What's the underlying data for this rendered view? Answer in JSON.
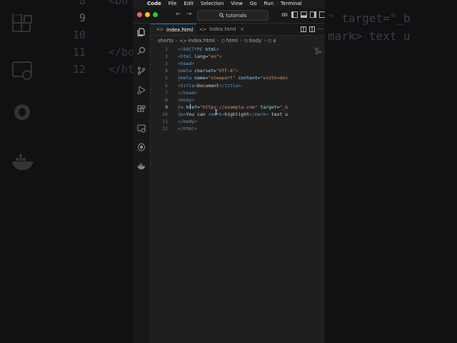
{
  "menubar": {
    "apple_icon": "",
    "items": [
      "Code",
      "File",
      "Edit",
      "Selection",
      "View",
      "Go",
      "Run",
      "Terminal"
    ]
  },
  "titlebar": {
    "command_center": "tutorials"
  },
  "tabs": [
    {
      "label": "index.html",
      "active": true
    },
    {
      "label": "index.html",
      "active": false
    }
  ],
  "breadcrumb": [
    "shorts",
    "index.html",
    "html",
    "body",
    "a"
  ],
  "editor": {
    "line_numbers": [
      "1",
      "2",
      "3",
      "4",
      "5",
      "6",
      "7",
      "8",
      "9",
      "10",
      "11",
      "12"
    ],
    "current_line": "9",
    "lines": [
      [
        [
          "t-br",
          "<!"
        ],
        [
          "t-dt",
          "DOCTYPE"
        ],
        [
          "t-txt",
          " "
        ],
        [
          "t-attr",
          "html"
        ],
        [
          "t-br",
          ">"
        ]
      ],
      [
        [
          "t-br",
          "<"
        ],
        [
          "t-tag",
          "html"
        ],
        [
          "t-txt",
          " "
        ],
        [
          "t-attr",
          "lang"
        ],
        [
          "t-txt",
          "="
        ],
        [
          "t-str",
          "\"en\""
        ],
        [
          "t-br",
          ">"
        ]
      ],
      [
        [
          "t-br",
          "<"
        ],
        [
          "t-tag",
          "head"
        ],
        [
          "t-br",
          ">"
        ]
      ],
      [
        [
          "t-txt",
          "    "
        ],
        [
          "t-br",
          "<"
        ],
        [
          "t-tag",
          "meta"
        ],
        [
          "t-txt",
          " "
        ],
        [
          "t-attr",
          "charset"
        ],
        [
          "t-txt",
          "="
        ],
        [
          "t-str",
          "\"UTF-8\""
        ],
        [
          "t-br",
          ">"
        ]
      ],
      [
        [
          "t-txt",
          "    "
        ],
        [
          "t-br",
          "<"
        ],
        [
          "t-tag",
          "meta"
        ],
        [
          "t-txt",
          " "
        ],
        [
          "t-attr",
          "name"
        ],
        [
          "t-txt",
          "="
        ],
        [
          "t-str",
          "\"viewport\""
        ],
        [
          "t-txt",
          " "
        ],
        [
          "t-attr",
          "content"
        ],
        [
          "t-txt",
          "="
        ],
        [
          "t-str",
          "\"width=dev"
        ]
      ],
      [
        [
          "t-txt",
          "    "
        ],
        [
          "t-br",
          "<"
        ],
        [
          "t-tag",
          "title"
        ],
        [
          "t-br",
          ">"
        ],
        [
          "t-txt",
          "Document"
        ],
        [
          "t-br",
          "</"
        ],
        [
          "t-tag",
          "title"
        ],
        [
          "t-br",
          ">"
        ]
      ],
      [
        [
          "t-br",
          "</"
        ],
        [
          "t-tag",
          "head"
        ],
        [
          "t-br",
          ">"
        ]
      ],
      [
        [
          "t-br",
          "<"
        ],
        [
          "t-tag",
          "body"
        ],
        [
          "t-br",
          ">"
        ]
      ],
      [
        [
          "t-txt",
          "    "
        ],
        [
          "t-br",
          "<"
        ],
        [
          "t-tag",
          "a"
        ],
        [
          "t-txt",
          " "
        ],
        [
          "t-attr",
          "href"
        ],
        [
          "t-txt",
          "="
        ],
        [
          "t-str",
          "\"https://example.com\""
        ],
        [
          "t-txt",
          " "
        ],
        [
          "t-attr",
          "target"
        ],
        [
          "t-txt",
          "="
        ],
        [
          "t-str",
          "\"_b"
        ]
      ],
      [
        [
          "t-txt",
          "    "
        ],
        [
          "t-br",
          "<"
        ],
        [
          "t-tag",
          "p"
        ],
        [
          "t-br",
          ">"
        ],
        [
          "t-txt",
          "You can "
        ],
        [
          "t-br",
          "<"
        ],
        [
          "t-tag",
          "mark"
        ],
        [
          "t-br",
          ">"
        ],
        [
          "t-txt",
          "highlight"
        ],
        [
          "t-br",
          "</"
        ],
        [
          "t-tag",
          "mark"
        ],
        [
          "t-br",
          ">"
        ],
        [
          "t-txt",
          " text u"
        ]
      ],
      [
        [
          "t-br",
          "</"
        ],
        [
          "t-tag",
          "body"
        ],
        [
          "t-br",
          ">"
        ]
      ],
      [
        [
          "t-br",
          "</"
        ],
        [
          "t-tag",
          "html"
        ],
        [
          "t-br",
          ">"
        ]
      ]
    ]
  },
  "background_left": {
    "line_numbers": [
      "8",
      "9",
      "10",
      "11",
      "12"
    ],
    "code": [
      "<bo",
      "",
      "",
      "</bo",
      "</ht"
    ]
  },
  "background_right": {
    "code": [
      "\" target=\"_b",
      "mark> text u"
    ]
  },
  "colors": {
    "accent": "#0078d4",
    "tag": "#569cd6",
    "attribute": "#9cdcfe",
    "string": "#ce9178"
  }
}
